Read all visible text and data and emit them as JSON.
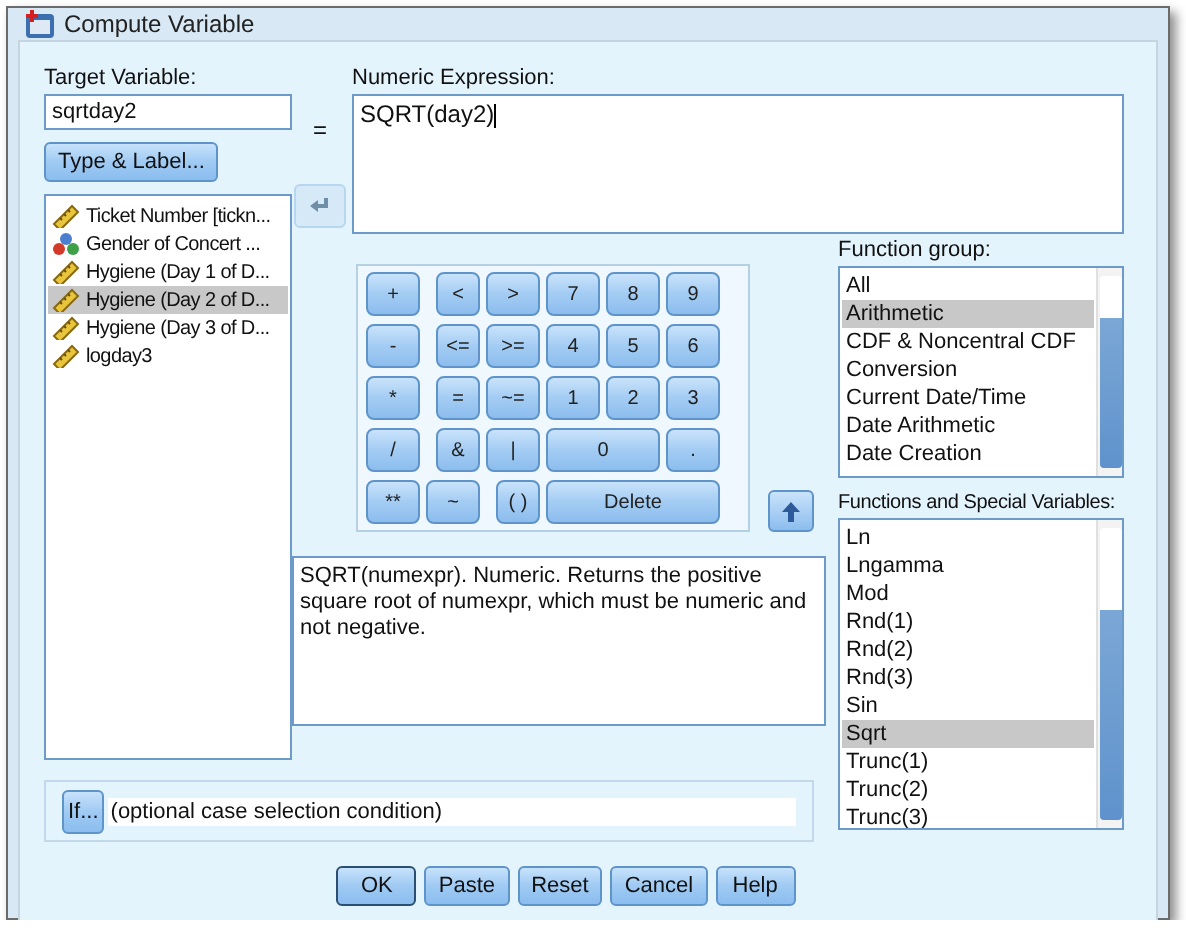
{
  "window": {
    "title": "Compute Variable"
  },
  "target": {
    "label": "Target Variable:",
    "value": "sqrtday2",
    "button": "Type & Label..."
  },
  "variables": [
    {
      "name": "Ticket Number [tickn...",
      "kind": "scale",
      "selected": false
    },
    {
      "name": "Gender of Concert ...",
      "kind": "nominal",
      "selected": false
    },
    {
      "name": "Hygiene (Day 1 of D...",
      "kind": "scale",
      "selected": false
    },
    {
      "name": "Hygiene (Day 2 of D...",
      "kind": "scale",
      "selected": true
    },
    {
      "name": "Hygiene (Day 3 of D...",
      "kind": "scale",
      "selected": false
    },
    {
      "name": "logday3",
      "kind": "scale",
      "selected": false
    }
  ],
  "equals": "=",
  "expression": {
    "label": "Numeric Expression:",
    "value": "SQRT(day2)"
  },
  "keypad": [
    {
      "label": "+",
      "kind": "key"
    },
    {
      "label": "<",
      "kind": "key"
    },
    {
      "label": ">",
      "kind": "key"
    },
    {
      "label": "7",
      "kind": "key"
    },
    {
      "label": "8",
      "kind": "key"
    },
    {
      "label": "9",
      "kind": "key"
    },
    {
      "label": "-",
      "kind": "key"
    },
    {
      "label": "<=",
      "kind": "key"
    },
    {
      "label": ">=",
      "kind": "key"
    },
    {
      "label": "4",
      "kind": "key"
    },
    {
      "label": "5",
      "kind": "key"
    },
    {
      "label": "6",
      "kind": "key"
    },
    {
      "label": "*",
      "kind": "key"
    },
    {
      "label": "=",
      "kind": "key"
    },
    {
      "label": "~=",
      "kind": "key"
    },
    {
      "label": "1",
      "kind": "key"
    },
    {
      "label": "2",
      "kind": "key"
    },
    {
      "label": "3",
      "kind": "key"
    },
    {
      "label": "/",
      "kind": "key"
    },
    {
      "label": "&",
      "kind": "key"
    },
    {
      "label": "|",
      "kind": "key"
    },
    {
      "label": "0",
      "kind": "double"
    },
    {
      "label": ".",
      "kind": "key"
    },
    {
      "label": "**",
      "kind": "key"
    },
    {
      "label": "~",
      "kind": "key"
    },
    {
      "label": "( )",
      "kind": "key"
    },
    {
      "label": "Delete",
      "kind": "triple"
    }
  ],
  "description": "SQRT(numexpr). Numeric. Returns the positive square root of numexpr, which must be numeric and not negative.",
  "function_group": {
    "label": "Function group:",
    "items": [
      {
        "name": "All",
        "selected": false
      },
      {
        "name": "Arithmetic",
        "selected": true
      },
      {
        "name": "CDF & Noncentral CDF",
        "selected": false
      },
      {
        "name": "Conversion",
        "selected": false
      },
      {
        "name": "Current Date/Time",
        "selected": false
      },
      {
        "name": "Date Arithmetic",
        "selected": false
      },
      {
        "name": "Date Creation",
        "selected": false
      }
    ]
  },
  "functions": {
    "label": "Functions and Special Variables:",
    "items": [
      {
        "name": "Ln",
        "selected": false
      },
      {
        "name": "Lngamma",
        "selected": false
      },
      {
        "name": "Mod",
        "selected": false
      },
      {
        "name": "Rnd(1)",
        "selected": false
      },
      {
        "name": "Rnd(2)",
        "selected": false
      },
      {
        "name": "Rnd(3)",
        "selected": false
      },
      {
        "name": "Sin",
        "selected": false
      },
      {
        "name": "Sqrt",
        "selected": true
      },
      {
        "name": "Trunc(1)",
        "selected": false
      },
      {
        "name": "Trunc(2)",
        "selected": false
      },
      {
        "name": "Trunc(3)",
        "selected": false
      }
    ]
  },
  "condition": {
    "button": "If...",
    "text": "(optional case selection condition)"
  },
  "buttons": [
    {
      "label": "OK",
      "default": true
    },
    {
      "label": "Paste",
      "default": false
    },
    {
      "label": "Reset",
      "default": false
    },
    {
      "label": "Cancel",
      "default": false
    },
    {
      "label": "Help",
      "default": false
    }
  ]
}
